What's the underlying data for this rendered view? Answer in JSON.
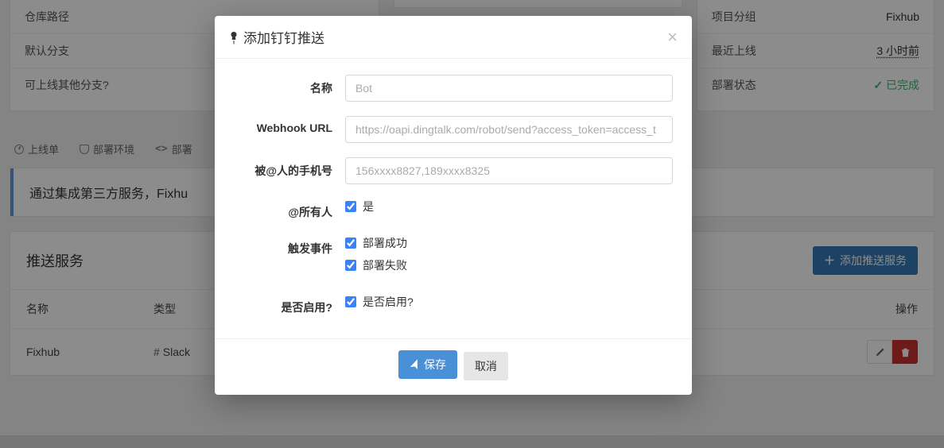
{
  "left_panel": {
    "rows": [
      {
        "label": "仓库路径",
        "value": ""
      },
      {
        "label": "默认分支",
        "value": ""
      },
      {
        "label": "可上线其他分支?",
        "value": ""
      }
    ]
  },
  "right_panel": {
    "rows": [
      {
        "label": "项目分组",
        "value": "Fixhub"
      },
      {
        "label": "最近上线",
        "value": "3 小时前"
      },
      {
        "label": "部署状态",
        "value": "已完成"
      }
    ]
  },
  "tabs": {
    "t1": "上线单",
    "t2": "部署环境",
    "t3": "部署"
  },
  "info_strip": "通过集成第三方服务，Fixhu",
  "push_section": {
    "title": "推送服务",
    "add_button": "添加推送服务",
    "columns": {
      "name": "名称",
      "type": "类型",
      "actions": "操作"
    },
    "row": {
      "name": "Fixhub",
      "type": "Slack"
    }
  },
  "modal": {
    "title": "添加钉钉推送",
    "fields": {
      "name_label": "名称",
      "name_placeholder": "Bot",
      "webhook_label": "Webhook URL",
      "webhook_placeholder": "https://oapi.dingtalk.com/robot/send?access_token=access_t",
      "phones_label": "被@人的手机号",
      "phones_placeholder": "156xxxx8827,189xxxx8325",
      "atall_label": "@所有人",
      "atall_option": "是",
      "events_label": "触发事件",
      "event_success": "部署成功",
      "event_fail": "部署失败",
      "enabled_label": "是否启用?",
      "enabled_option": "是否启用?"
    },
    "buttons": {
      "save": "保存",
      "cancel": "取消"
    }
  }
}
